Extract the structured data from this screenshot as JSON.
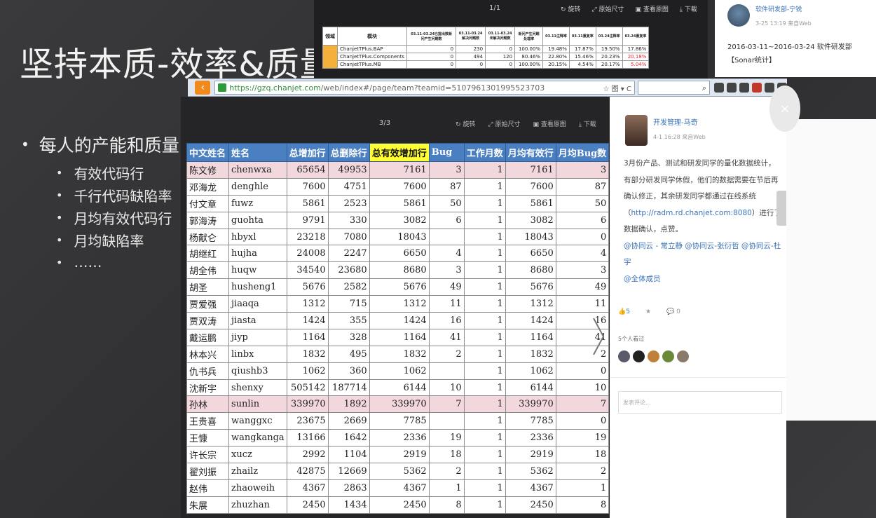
{
  "slide": {
    "title": "坚持本质-效率&质量",
    "bullet_main": "每人的产能和质量",
    "sub_bullets": [
      "有效代码行",
      "千行代码缺陷率",
      "月均有效代码行",
      "月均缺陷率",
      "……"
    ]
  },
  "top_viewer": {
    "pager": "1/1",
    "actions": [
      "旋转",
      "原始尺寸",
      "查看原图",
      "下载"
    ],
    "table": {
      "headers": [
        "领域",
        "模块",
        "03.11-03.24已提出数新问产生问题数",
        "03.11-03.24解决问题数",
        "03.11-03.24未解决问题数",
        "新问产生问题处理率",
        "03.11注释率",
        "03.11重复率",
        "03.24注释率",
        "03.24重复率"
      ],
      "rows": [
        [
          "",
          "ChanjetTPlus.BAP",
          "0",
          "230",
          "0",
          "100.00%",
          "19.48%",
          "17.87%",
          "19.50%",
          "17.86%"
        ],
        [
          "",
          "ChanjetTPlus.Components",
          "0",
          "494",
          "120",
          "80.46%",
          "22.80%",
          "15.46%",
          "20.23%",
          "20.18%"
        ],
        [
          "",
          "ChanjetTPlus.MB",
          "0",
          "0",
          "0",
          "100.00%",
          "20.15%",
          "4.54%",
          "20.17%",
          "5.04%"
        ]
      ]
    }
  },
  "top_card": {
    "name": "软件研发部-宁锐",
    "time": "3-25 13:19  来自Web",
    "text": "2016-03-11~2016-03-24 软件研发部【Sonar统计】"
  },
  "browser": {
    "url_host": "https://gzq.chanjet.com",
    "url_path": "/web/index#/page/team?teamid=5107961301995523703",
    "right_tools": "☆ 图 ▾  C"
  },
  "main_viewer": {
    "pager": "3/3",
    "actions": [
      "旋转",
      "原始尺寸",
      "查看原图",
      "下载"
    ]
  },
  "table": {
    "headers": [
      "中文姓名",
      "姓名",
      "总增加行",
      "总删除行",
      "总有效增加行",
      "Bug",
      "工作月数",
      "月均有效行",
      "月均Bug数"
    ],
    "rows": [
      {
        "cn": "陈文修",
        "user": "chenwxa",
        "add": "65654",
        "del": "49953",
        "valid": "7161",
        "bug": "3",
        "months": "1",
        "avg": "7161",
        "avgbug": "3",
        "pink": true
      },
      {
        "cn": "邓海龙",
        "user": "denghle",
        "add": "7600",
        "del": "4751",
        "valid": "7600",
        "bug": "87",
        "months": "1",
        "avg": "7600",
        "avgbug": "87",
        "pink": false
      },
      {
        "cn": "付文章",
        "user": "fuwz",
        "add": "5861",
        "del": "2523",
        "valid": "5861",
        "bug": "50",
        "months": "1",
        "avg": "5861",
        "avgbug": "50",
        "pink": false
      },
      {
        "cn": "郭海涛",
        "user": "guohta",
        "add": "9791",
        "del": "330",
        "valid": "3082",
        "bug": "6",
        "months": "1",
        "avg": "3082",
        "avgbug": "6",
        "pink": false
      },
      {
        "cn": "杨献仑",
        "user": "hbyxl",
        "add": "23218",
        "del": "7080",
        "valid": "18043",
        "bug": "",
        "months": "1",
        "avg": "18043",
        "avgbug": "0",
        "pink": false
      },
      {
        "cn": "胡继红",
        "user": "hujha",
        "add": "24008",
        "del": "2247",
        "valid": "6650",
        "bug": "4",
        "months": "1",
        "avg": "6650",
        "avgbug": "4",
        "pink": false
      },
      {
        "cn": "胡全伟",
        "user": "huqw",
        "add": "34540",
        "del": "23680",
        "valid": "8680",
        "bug": "3",
        "months": "1",
        "avg": "8680",
        "avgbug": "3",
        "pink": false
      },
      {
        "cn": "胡圣",
        "user": "husheng1",
        "add": "5676",
        "del": "2582",
        "valid": "5676",
        "bug": "49",
        "months": "1",
        "avg": "5676",
        "avgbug": "49",
        "pink": false
      },
      {
        "cn": "贾爱强",
        "user": "jiaaqa",
        "add": "1312",
        "del": "715",
        "valid": "1312",
        "bug": "11",
        "months": "1",
        "avg": "1312",
        "avgbug": "11",
        "pink": false
      },
      {
        "cn": "贾双涛",
        "user": "jiasta",
        "add": "1424",
        "del": "355",
        "valid": "1424",
        "bug": "16",
        "months": "1",
        "avg": "1424",
        "avgbug": "16",
        "pink": false
      },
      {
        "cn": "戴运鹏",
        "user": "jiyp",
        "add": "1164",
        "del": "328",
        "valid": "1164",
        "bug": "41",
        "months": "1",
        "avg": "1164",
        "avgbug": "41",
        "pink": false
      },
      {
        "cn": "林本兴",
        "user": "linbx",
        "add": "1832",
        "del": "495",
        "valid": "1832",
        "bug": "2",
        "months": "1",
        "avg": "1832",
        "avgbug": "2",
        "pink": false
      },
      {
        "cn": "仇书兵",
        "user": "qiushb3",
        "add": "1062",
        "del": "360",
        "valid": "1062",
        "bug": "",
        "months": "1",
        "avg": "1062",
        "avgbug": "0",
        "pink": false
      },
      {
        "cn": "沈新宇",
        "user": "shenxy",
        "add": "505142",
        "del": "187714",
        "valid": "6144",
        "bug": "10",
        "months": "1",
        "avg": "6144",
        "avgbug": "10",
        "pink": false
      },
      {
        "cn": "孙林",
        "user": "sunlin",
        "add": "339970",
        "del": "1892",
        "valid": "339970",
        "bug": "7",
        "months": "1",
        "avg": "339970",
        "avgbug": "7",
        "pink": true
      },
      {
        "cn": "王贵喜",
        "user": "wanggxc",
        "add": "23675",
        "del": "2669",
        "valid": "7785",
        "bug": "",
        "months": "1",
        "avg": "7785",
        "avgbug": "0",
        "pink": false
      },
      {
        "cn": "王慷",
        "user": "wangkanga",
        "add": "13166",
        "del": "1642",
        "valid": "2336",
        "bug": "19",
        "months": "1",
        "avg": "2336",
        "avgbug": "19",
        "pink": false
      },
      {
        "cn": "许长宗",
        "user": "xucz",
        "add": "2992",
        "del": "1104",
        "valid": "2919",
        "bug": "18",
        "months": "1",
        "avg": "2919",
        "avgbug": "18",
        "pink": false
      },
      {
        "cn": "翟刘振",
        "user": "zhailz",
        "add": "42875",
        "del": "12669",
        "valid": "5362",
        "bug": "2",
        "months": "1",
        "avg": "5362",
        "avgbug": "2",
        "pink": false
      },
      {
        "cn": "赵伟",
        "user": "zhaoweih",
        "add": "4367",
        "del": "2863",
        "valid": "4367",
        "bug": "1",
        "months": "1",
        "avg": "4367",
        "avgbug": "1",
        "pink": false
      },
      {
        "cn": "朱展",
        "user": "zhuzhan",
        "add": "2450",
        "del": "1434",
        "valid": "2450",
        "bug": "8",
        "months": "1",
        "avg": "2450",
        "avgbug": "8",
        "pink": false
      }
    ]
  },
  "post": {
    "author": "开发管理-马奇",
    "time": "4-1 16:28  来自Web",
    "text_before_link": "3月份产品、测试和研发同学的量化数据统计，有部分研发同学休假，他们的数据需要在节后再确认修正，其余研发同学都通过在线系统（",
    "link": "http://radm.rd.chanjet.com:8080",
    "text_after_link": "）进行了数据确认，点赞。",
    "mentions": "@协同云 - 常立静 @协同云-张衍哲 @协同云-杜宇",
    "mention_all": "@全体成员",
    "likes": "5",
    "comments": "0",
    "viewers_label": "5个人看过",
    "comment_placeholder": "发表评论..."
  },
  "colors": {
    "header_blue": "#4a80c2",
    "header_highlight": "#ffff33",
    "pink_row": "#f2d8dc",
    "link_blue": "#3973b8",
    "back_orange": "#f08a1c"
  }
}
